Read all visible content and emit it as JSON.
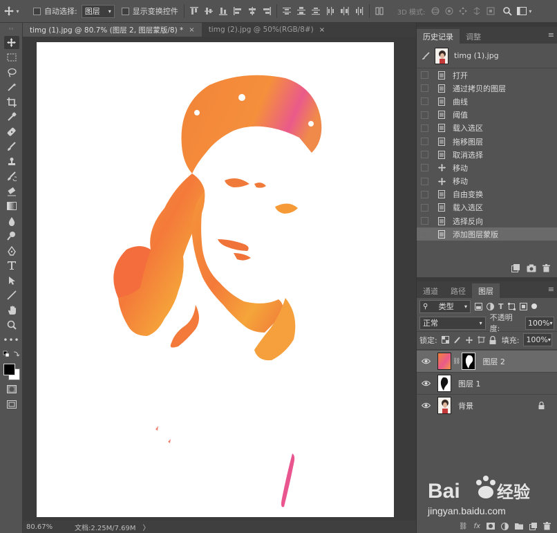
{
  "options_bar": {
    "auto_select_label": "自动选择:",
    "auto_select_value": "图层",
    "show_transform_label": "显示变换控件",
    "mode_3d_label": "3D 模式:"
  },
  "tabs": [
    {
      "label": "timg (1).jpg @ 80.7% (图层 2, 图层蒙版/8) *",
      "close": "×"
    },
    {
      "label": "timg (2).jpg @ 50%(RGB/8#)",
      "close": "×"
    }
  ],
  "status": {
    "zoom": "80.67%",
    "doc_info": "文档:2.25M/7.69M",
    "arrow": "〉"
  },
  "history_panel": {
    "tabs": [
      "历史记录",
      "调整"
    ],
    "snapshot_name": "timg (1).jpg",
    "items": [
      {
        "label": "打开",
        "icon": "document-icon"
      },
      {
        "label": "通过拷贝的图层",
        "icon": "document-icon"
      },
      {
        "label": "曲线",
        "icon": "document-icon"
      },
      {
        "label": "阈值",
        "icon": "document-icon"
      },
      {
        "label": "载入选区",
        "icon": "document-icon"
      },
      {
        "label": "拖移图层",
        "icon": "document-icon"
      },
      {
        "label": "取消选择",
        "icon": "document-icon"
      },
      {
        "label": "移动",
        "icon": "move-icon"
      },
      {
        "label": "移动",
        "icon": "move-icon"
      },
      {
        "label": "自由变换",
        "icon": "document-icon"
      },
      {
        "label": "载入选区",
        "icon": "document-icon"
      },
      {
        "label": "选择反向",
        "icon": "document-icon"
      },
      {
        "label": "添加图层蒙版",
        "icon": "document-icon",
        "current": true
      }
    ]
  },
  "layers_panel": {
    "tabs": [
      "通道",
      "路径",
      "图层"
    ],
    "filter_value": "类型",
    "blend_mode": "正常",
    "opacity_label": "不透明度:",
    "opacity_value": "100%",
    "lock_label": "锁定:",
    "fill_label": "填充:",
    "fill_value": "100%",
    "layers": [
      {
        "name": "图层 2",
        "active": true,
        "has_mask": true
      },
      {
        "name": "图层 1",
        "active": false
      },
      {
        "name": "背景",
        "active": false,
        "locked": true
      }
    ]
  },
  "colors": {
    "accent_orange": "#f5823a",
    "accent_pink": "#e9558e",
    "ui_bg": "#535353",
    "canvas_bg": "#3b3b3b"
  },
  "watermark": "Bai 经验 jingyan.baidu.com"
}
